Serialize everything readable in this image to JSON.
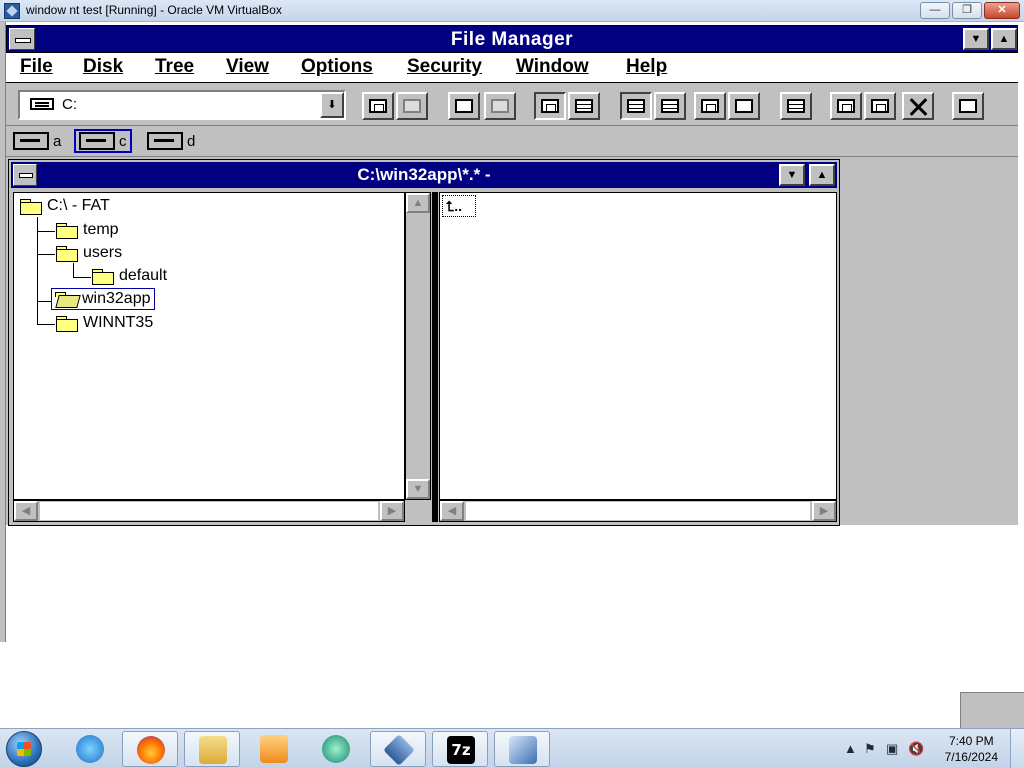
{
  "host": {
    "title": "window nt test [Running] - Oracle VM VirtualBox",
    "buttons": {
      "minimize": "—",
      "maximize": "❐",
      "close": "✕"
    }
  },
  "app": {
    "title": "File Manager",
    "menu": [
      "File",
      "Disk",
      "Tree",
      "View",
      "Options",
      "Security",
      "Window",
      "Help"
    ],
    "drive_combo": {
      "value": "C:",
      "icon": "hard-drive-icon"
    },
    "toolbar_icons": [
      "connect-network-drive-icon",
      "disconnect-network-drive-icon",
      "share-as-icon",
      "stop-sharing-icon",
      "large-icons-view-icon",
      "list-view-icon",
      "sort-by-name-icon",
      "sort-by-type-icon",
      "new-window-icon",
      "properties-icon",
      "move-icon",
      "copy-icon",
      "paste-icon",
      "delete-icon",
      "security-icon"
    ],
    "drives": [
      {
        "letter": "a",
        "icon": "floppy-drive-icon",
        "selected": false
      },
      {
        "letter": "c",
        "icon": "hard-drive-icon",
        "selected": true
      },
      {
        "letter": "d",
        "icon": "cdrom-drive-icon",
        "selected": false
      }
    ]
  },
  "child": {
    "title": "C:\\win32app\\*.* -",
    "tree": {
      "root": "C:\\ - FAT",
      "items": [
        {
          "name": "temp"
        },
        {
          "name": "users"
        },
        {
          "name": "default"
        },
        {
          "name": "win32app"
        },
        {
          "name": "WINNT35"
        }
      ]
    },
    "contents": [
      {
        "name": "..",
        "icon": "up-directory-icon"
      }
    ]
  },
  "taskbar": {
    "items": [
      "start-button",
      "internet-explorer-icon",
      "firefox-icon",
      "file-explorer-icon",
      "media-player-icon",
      "browser-icon",
      "virtualbox-icon",
      "7zip-icon",
      "windows-nt-vm-icon"
    ],
    "sevenzip_label": "7z",
    "clock": {
      "time": "7:40 PM",
      "date": "7/16/2024"
    },
    "tray_icons": [
      "show-hidden-icons",
      "action-center-flag-icon",
      "network-icon",
      "volume-muted-icon"
    ]
  },
  "colors": {
    "titlebar": "#000080",
    "face": "#c0c0c0",
    "folder": "#ffff80"
  }
}
